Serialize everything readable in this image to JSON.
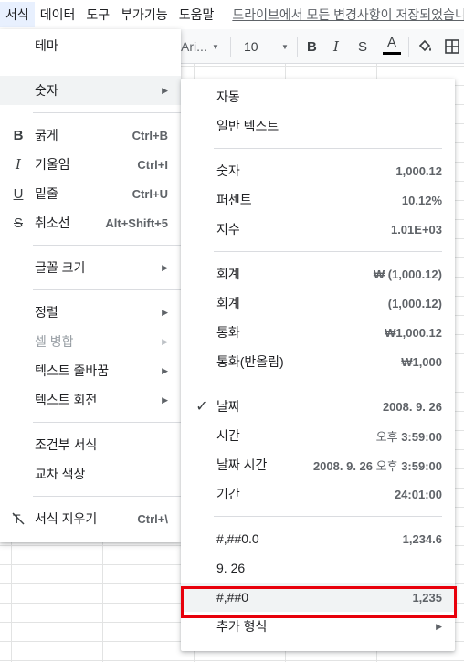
{
  "menubar": {
    "items": [
      "서식",
      "데이터",
      "도구",
      "부가기능",
      "도움말"
    ],
    "save_note": "드라이브에서 모든 변경사항이 저장되었습니다"
  },
  "toolbar": {
    "font_name": "Ari...",
    "font_size": "10"
  },
  "format_menu": {
    "theme": "테마",
    "number": "숫자",
    "bold": {
      "label": "굵게",
      "shortcut": "Ctrl+B"
    },
    "italic": {
      "label": "기울임",
      "shortcut": "Ctrl+I"
    },
    "underline": {
      "label": "밑줄",
      "shortcut": "Ctrl+U"
    },
    "strikethrough": {
      "label": "취소선",
      "shortcut": "Alt+Shift+5"
    },
    "font_size": "글꼴 크기",
    "align": "정렬",
    "merge_cells": "셀 병합",
    "text_wrapping": "텍스트 줄바꿈",
    "text_rotation": "텍스트 회전",
    "conditional_formatting": "조건부 서식",
    "alternating_colors": "교차 색상",
    "clear_formatting": {
      "label": "서식 지우기",
      "shortcut": "Ctrl+\\"
    }
  },
  "number_menu": {
    "automatic": "자동",
    "plain_text": "일반 텍스트",
    "number": {
      "label": "숫자",
      "value": "1,000.12"
    },
    "percent": {
      "label": "퍼센트",
      "value": "10.12%"
    },
    "scientific": {
      "label": "지수",
      "value": "1.01E+03"
    },
    "accounting": {
      "label": "회계",
      "value": "₩ (1,000.12)"
    },
    "financial": {
      "label": "회계",
      "value": "(1,000.12)"
    },
    "currency": {
      "label": "통화",
      "value": "₩1,000.12"
    },
    "currency_rounded": {
      "label": "통화(반올림)",
      "value": "₩1,000"
    },
    "date": {
      "label": "날짜",
      "value": "2008. 9. 26"
    },
    "time": {
      "label": "시간",
      "value_ampm": "오후",
      "value": "3:59:00"
    },
    "date_time": {
      "label": "날짜 시간",
      "value_date": "2008. 9. 26",
      "value_ampm": "오후",
      "value": "3:59:00"
    },
    "duration": {
      "label": "기간",
      "value": "24:01:00"
    },
    "custom1": {
      "label": "#,##0.0",
      "value": "1,234.6"
    },
    "custom2": {
      "label": "9. 26",
      "value": ""
    },
    "custom3": {
      "label": "#,##0",
      "value": "1,235"
    },
    "more_formats": "추가 형식"
  }
}
